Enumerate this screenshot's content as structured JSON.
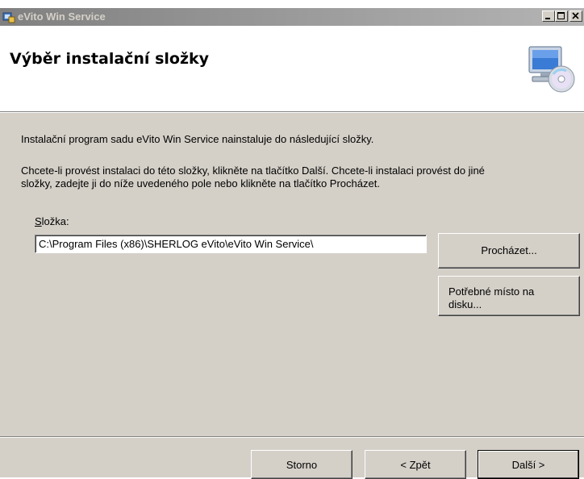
{
  "window": {
    "title": "eVito Win Service",
    "controls": [
      "minimize-icon",
      "maximize-icon",
      "close-icon"
    ]
  },
  "header": {
    "title": "Výběr instalační složky",
    "graphic": "computer-cd-icon"
  },
  "body": {
    "intro": "Instalační program sadu eVito Win Service nainstaluje do následující složky.",
    "instructions_line1": "Chcete-li provést instalaci do této složky, klikněte na tlačítko Další. Chcete-li instalaci provést do jiné",
    "instructions_line2": "složky, zadejte ji do níže uvedeného pole nebo klikněte na tlačítko Procházet.",
    "folder_label_accel": "S",
    "folder_label_rest": "ložka:",
    "folder_value": "C:\\Program Files (x86)\\SHERLOG eVito\\eVito Win Service\\"
  },
  "buttons": {
    "browse": "Procházet...",
    "disk_space_line1": "Potřebné místo na",
    "disk_space_line2": "disku...",
    "cancel": "Storno",
    "back": "< Zpět",
    "next": "Další >"
  }
}
